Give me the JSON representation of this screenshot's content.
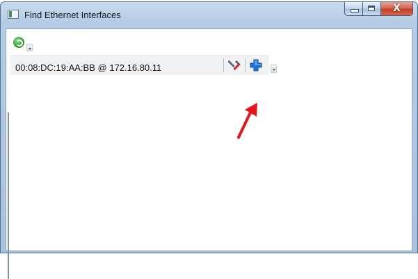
{
  "window": {
    "title": "Find Ethernet Interfaces",
    "caption_buttons": [
      "minimize",
      "maximize",
      "close"
    ],
    "close_glyph": "X"
  },
  "toolbar": {
    "refresh_icon": "refresh-icon",
    "menu_icon": "chevron-down-icon"
  },
  "interfaces": [
    {
      "label": "00:08:DC:19:AA:BB @ 172.16.80.11",
      "actions": [
        {
          "name": "configure",
          "icon": "tools-icon"
        },
        {
          "name": "add",
          "icon": "plus-icon"
        }
      ]
    }
  ],
  "annotation": {
    "type": "arrow",
    "color": "#e8141b"
  },
  "colors": {
    "title_bar": "#b3cbe4",
    "close_button": "#c03e26",
    "plus_icon": "#1e73d8",
    "row_background": "#f1f2f4"
  }
}
